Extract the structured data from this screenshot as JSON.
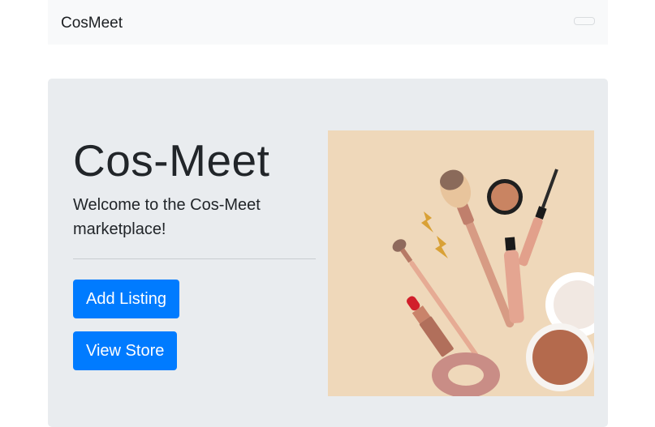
{
  "navbar": {
    "brand": "CosMeet"
  },
  "hero": {
    "title": "Cos-Meet",
    "lead": "Welcome to the Cos-Meet marketplace!",
    "buttons": {
      "add_listing": "Add Listing",
      "view_store": "View Store"
    },
    "image": {
      "subject": "makeup-products"
    }
  },
  "colors": {
    "primary": "#007bff",
    "navbar_bg": "#f8f9fa",
    "jumbotron_bg": "#e9ecef",
    "image_bg": "#efd8ba"
  }
}
